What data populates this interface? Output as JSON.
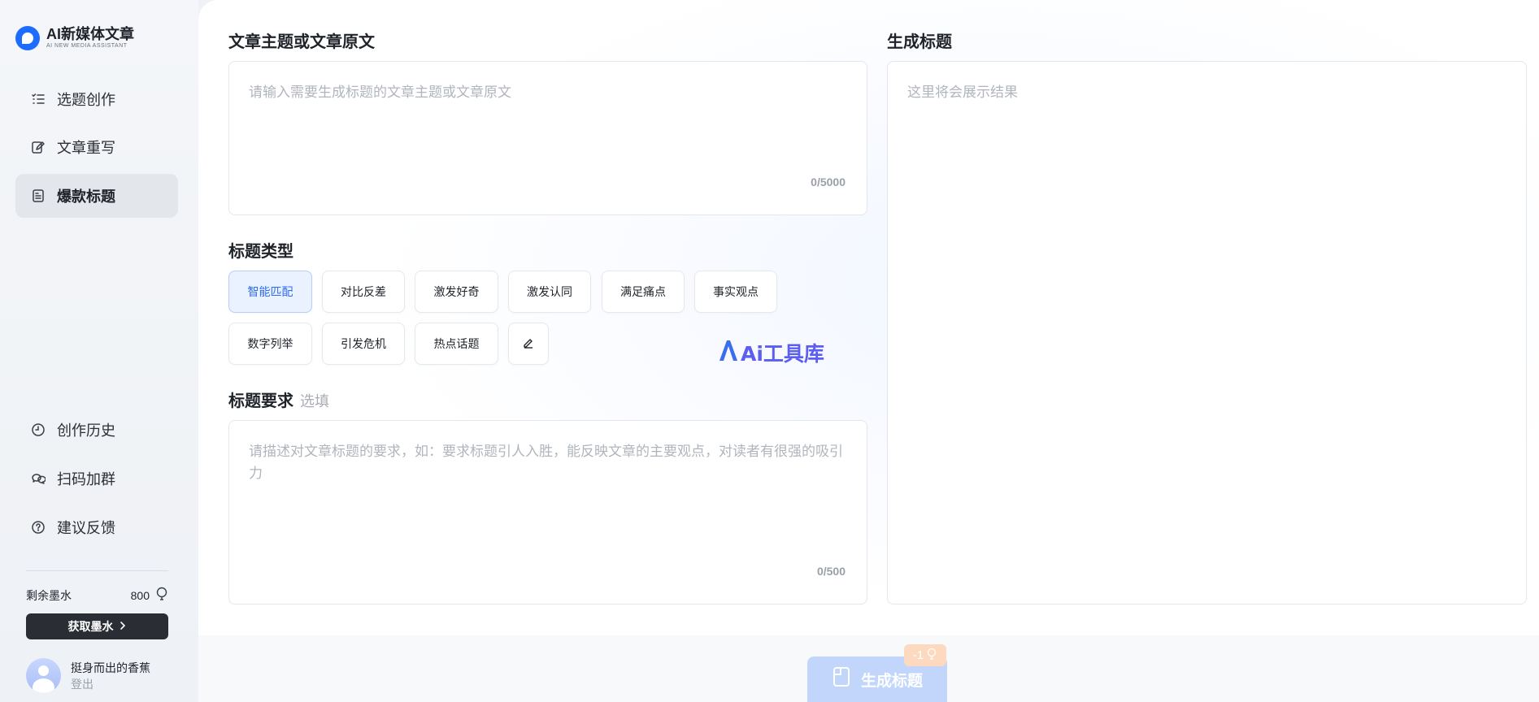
{
  "sidebar": {
    "logo_title": "AI新媒体文章",
    "logo_subtitle": "AI NEW MEDIA ASSISTANT",
    "nav": [
      {
        "label": "选题创作",
        "icon": "list-check-icon"
      },
      {
        "label": "文章重写",
        "icon": "pen-rewrite-icon"
      },
      {
        "label": "爆款标题",
        "icon": "document-icon",
        "active": true
      }
    ],
    "bottom_nav": [
      {
        "label": "创作历史",
        "icon": "clock-icon"
      },
      {
        "label": "扫码加群",
        "icon": "chat-group-icon"
      },
      {
        "label": "建议反馈",
        "icon": "question-circle-icon"
      }
    ],
    "ink_label": "剩余墨水",
    "ink_value": "800",
    "get_ink_label": "获取墨水",
    "user_name": "挺身而出的香蕉",
    "logout_label": "登出"
  },
  "main": {
    "source_title": "文章主题或文章原文",
    "source_placeholder": "请输入需要生成标题的文章主题或文章原文",
    "source_counter": "0/5000",
    "result_title": "生成标题",
    "result_placeholder": "这里将会展示结果",
    "type_title": "标题类型",
    "types": [
      "智能匹配",
      "对比反差",
      "激发好奇",
      "激发认同",
      "满足痛点",
      "事实观点",
      "数字列举",
      "引发危机",
      "热点话题"
    ],
    "active_type": "智能匹配",
    "req_title": "标题要求",
    "req_optional": "选填",
    "req_placeholder": "请描述对文章标题的要求，如：要求标题引人入胜，能反映文章的主要观点，对读者有很强的吸引力",
    "req_counter": "0/500",
    "watermark": "Ai工具库",
    "generate_label": "生成标题",
    "cost_badge": "-1"
  },
  "colors": {
    "accent": "#1e6bff",
    "active_tag_bg": "#eaf1ff",
    "generate_disabled": "#c2d6fb",
    "cost_badge": "#fcd9bf"
  }
}
